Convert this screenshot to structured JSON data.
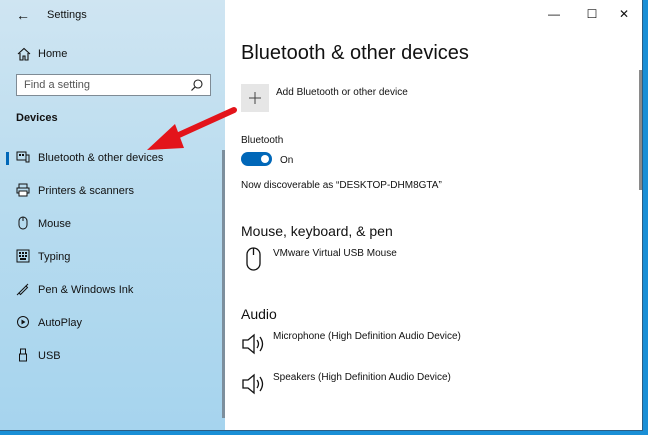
{
  "app": {
    "title": "Settings",
    "back_icon": "back-arrow-icon"
  },
  "sidebar": {
    "home_label": "Home",
    "search": {
      "placeholder": "Find a setting",
      "value": ""
    },
    "section_title": "Devices",
    "items": [
      {
        "label": "Bluetooth & other devices",
        "icon": "bluetooth-devices-icon",
        "selected": true
      },
      {
        "label": "Printers & scanners",
        "icon": "printer-icon",
        "selected": false
      },
      {
        "label": "Mouse",
        "icon": "mouse-icon",
        "selected": false
      },
      {
        "label": "Typing",
        "icon": "keyboard-icon",
        "selected": false
      },
      {
        "label": "Pen & Windows Ink",
        "icon": "pen-icon",
        "selected": false
      },
      {
        "label": "AutoPlay",
        "icon": "autoplay-icon",
        "selected": false
      },
      {
        "label": "USB",
        "icon": "usb-icon",
        "selected": false
      }
    ]
  },
  "window_controls": {
    "minimize": "—",
    "maximize": "☐",
    "close": "✕"
  },
  "main": {
    "title": "Bluetooth & other devices",
    "add_device_label": "Add Bluetooth or other device",
    "bluetooth": {
      "label": "Bluetooth",
      "toggle_state": "On",
      "enabled": true,
      "discoverable_text": "Now discoverable as “DESKTOP-DHM8GTA”"
    },
    "sections": {
      "mouse_keyboard_pen": {
        "title": "Mouse, keyboard, & pen",
        "devices": [
          {
            "name": "VMware Virtual USB Mouse",
            "icon": "mouse-icon"
          }
        ]
      },
      "audio": {
        "title": "Audio",
        "devices": [
          {
            "name": "Microphone (High Definition Audio Device)",
            "icon": "speaker-icon"
          },
          {
            "name": "Speakers (High Definition Audio Device)",
            "icon": "speaker-icon"
          }
        ]
      }
    }
  },
  "colors": {
    "accent": "#0067b8",
    "annotation_arrow": "#e3141b",
    "sidebar_bg": "#b9dcef",
    "desktop": "#1a8fd6"
  }
}
